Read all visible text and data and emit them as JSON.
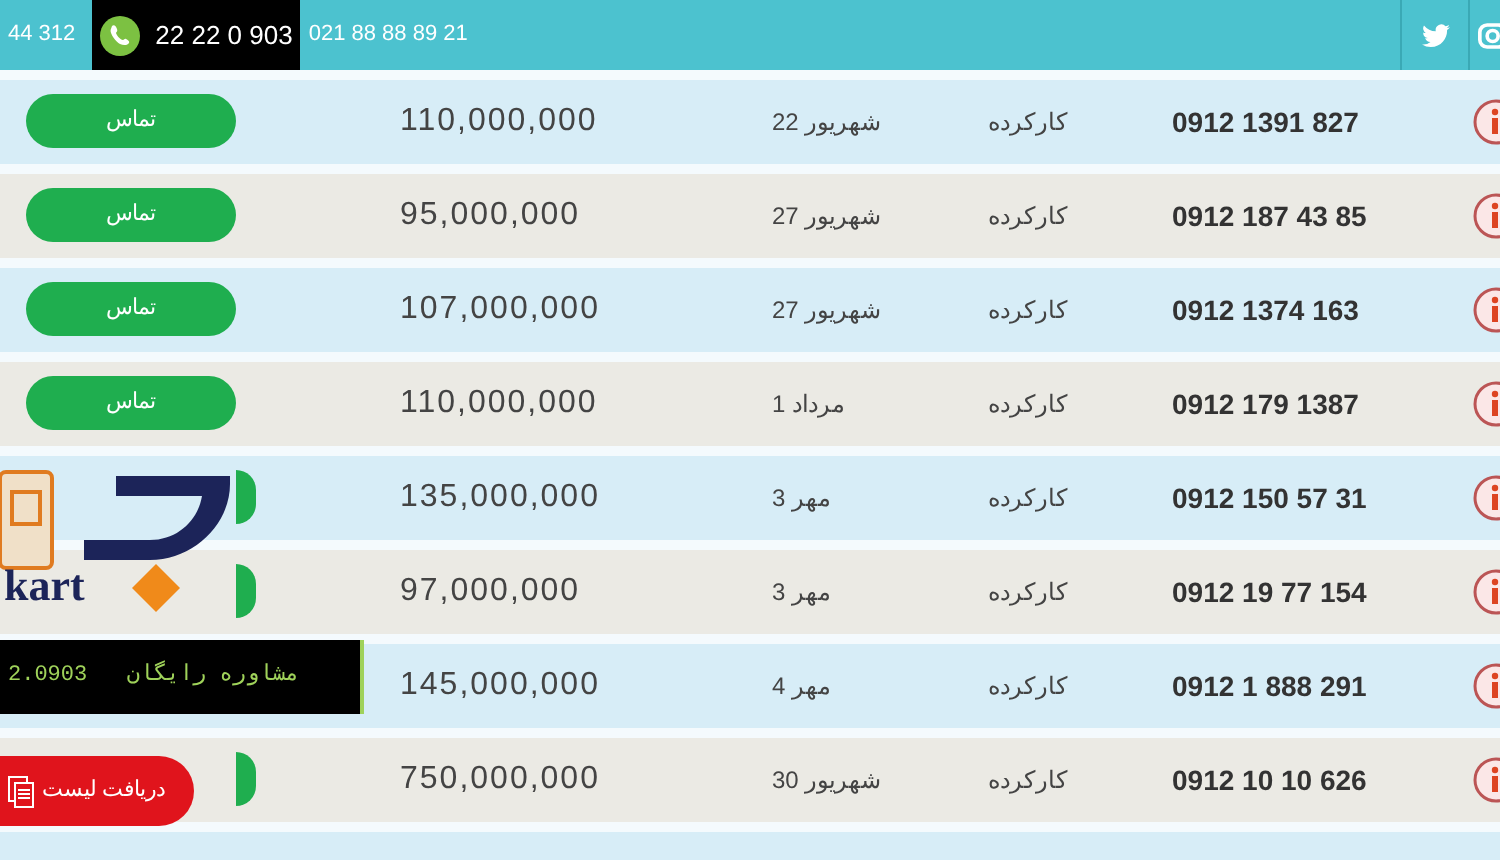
{
  "top_bar": {
    "phone_partial": "44 312",
    "hotline": "22 22 0 903",
    "phone": "021 88 88 89 21"
  },
  "rows": [
    {
      "button": "تماس",
      "price": "110,000,000",
      "date": "22 شهریور",
      "condition": "کارکرده",
      "number": "0912 1391 827"
    },
    {
      "button": "تماس",
      "price": "95,000,000",
      "date": "27 شهریور",
      "condition": "کارکرده",
      "number": "0912 187 43 85"
    },
    {
      "button": "تماس",
      "price": "107,000,000",
      "date": "27 شهریور",
      "condition": "کارکرده",
      "number": "0912 1374 163"
    },
    {
      "button": "تماس",
      "price": "110,000,000",
      "date": "1 مرداد",
      "condition": "کارکرده",
      "number": "0912 179 1387"
    },
    {
      "kind": "tail",
      "price": "135,000,000",
      "date": "3 مهر",
      "condition": "کارکرده",
      "number": "0912 150 57 31"
    },
    {
      "kind": "tail",
      "price": "97,000,000",
      "date": "3 مهر",
      "condition": "کارکرده",
      "number": "0912 19 77 154"
    },
    {
      "kind": "hidden",
      "price": "145,000,000",
      "date": "4 مهر",
      "condition": "کارکرده",
      "number": "0912 1 888 291"
    },
    {
      "kind": "tail",
      "price": "750,000,000",
      "date": "30 شهریور",
      "condition": "کارکرده",
      "number": "0912 10 10 626"
    },
    {
      "kind": "hidden"
    }
  ],
  "logo": {
    "text": "kart"
  },
  "consult_bar": {
    "text": "2.0903   مشاوره رایگان"
  },
  "download_button": {
    "label": "دریافت لیست"
  }
}
